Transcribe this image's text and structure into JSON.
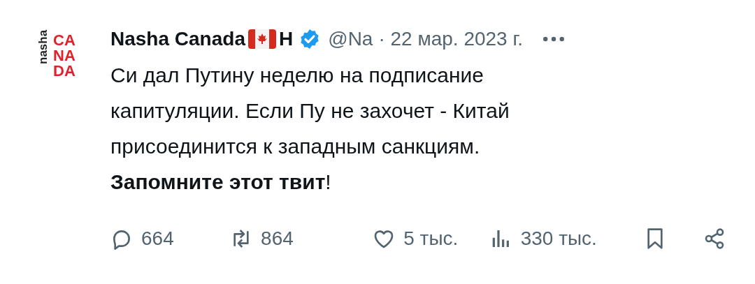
{
  "avatar": {
    "word": "nasha",
    "lines": [
      "CA",
      "NA",
      "DA"
    ]
  },
  "author": {
    "name": "Nasha Canada",
    "name_rest": "H",
    "verified": true,
    "handle": "@Na",
    "date": "· 22 мар. 2023 г."
  },
  "tweet": {
    "text": "Си дал Путину неделю на подписание капитуляции. Если Пу не захочет - Китай присоединится к западным санкциям.\n**Запомните этот твит**!"
  },
  "actions": [
    {
      "kind": "reply",
      "count": "664"
    },
    {
      "kind": "retweet",
      "count": "864"
    },
    {
      "kind": "like",
      "count": "5 тыс."
    },
    {
      "kind": "views",
      "count": "330 тыс."
    },
    {
      "kind": "bookmark"
    },
    {
      "kind": "share"
    }
  ]
}
